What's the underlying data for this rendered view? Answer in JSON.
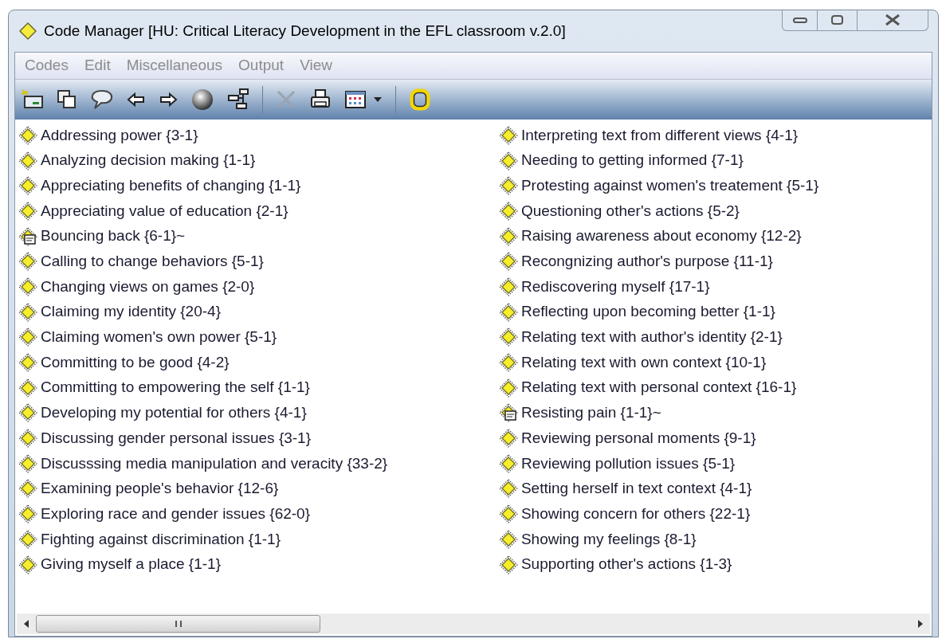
{
  "window": {
    "title": "Code Manager [HU: Critical Literacy Development in the EFL classroom v.2.0]"
  },
  "menu": [
    "Codes",
    "Edit",
    "Miscellaneous",
    "Output",
    "View"
  ],
  "codes": [
    {
      "label": "Addressing power {3-1}",
      "kind": "code"
    },
    {
      "label": "Analyzing decision making {1-1}",
      "kind": "code"
    },
    {
      "label": "Appreciating benefits of changing {1-1}",
      "kind": "code"
    },
    {
      "label": "Appreciating value of education {2-1}",
      "kind": "code"
    },
    {
      "label": "Bouncing back {6-1}~",
      "kind": "commented"
    },
    {
      "label": "Calling to change behaviors {5-1}",
      "kind": "code"
    },
    {
      "label": "Changing views on games {2-0}",
      "kind": "code"
    },
    {
      "label": "Claiming my identity {20-4}",
      "kind": "code"
    },
    {
      "label": "Claiming women's own power {5-1}",
      "kind": "code"
    },
    {
      "label": "Committing to be good {4-2}",
      "kind": "code"
    },
    {
      "label": "Committing to empowering the self {1-1}",
      "kind": "code"
    },
    {
      "label": "Developing my potential for others {4-1}",
      "kind": "code"
    },
    {
      "label": "Discussing gender personal issues {3-1}",
      "kind": "code"
    },
    {
      "label": "Discusssing media manipulation and veracity {33-2}",
      "kind": "code"
    },
    {
      "label": "Examining people's behavior {12-6}",
      "kind": "code"
    },
    {
      "label": "Exploring race and gender issues {62-0}",
      "kind": "code"
    },
    {
      "label": "Fighting against discrimination {1-1}",
      "kind": "code"
    },
    {
      "label": "Giving myself a place {1-1}",
      "kind": "code"
    },
    {
      "label": "Interpreting text from different views {4-1}",
      "kind": "code"
    },
    {
      "label": "Needing to getting informed {7-1}",
      "kind": "code"
    },
    {
      "label": "Protesting against women's treatement {5-1}",
      "kind": "code"
    },
    {
      "label": "Questioning other's actions {5-2}",
      "kind": "code"
    },
    {
      "label": "Raising awareness about economy {12-2}",
      "kind": "code"
    },
    {
      "label": "Recongnizing author's purpose {11-1}",
      "kind": "code"
    },
    {
      "label": "Rediscovering myself {17-1}",
      "kind": "code"
    },
    {
      "label": "Reflecting upon becoming better {1-1}",
      "kind": "code"
    },
    {
      "label": "Relating text with author's identity {2-1}",
      "kind": "code"
    },
    {
      "label": "Relating text with own context {10-1}",
      "kind": "code"
    },
    {
      "label": "Relating text with personal context {16-1}",
      "kind": "code"
    },
    {
      "label": "Resisting pain {1-1}~",
      "kind": "commented"
    },
    {
      "label": "Reviewing personal moments {9-1}",
      "kind": "code"
    },
    {
      "label": "Reviewing pollution issues {5-1}",
      "kind": "code"
    },
    {
      "label": "Setting herself in text context {4-1}",
      "kind": "code"
    },
    {
      "label": "Showing concern for others {22-1}",
      "kind": "code"
    },
    {
      "label": "Showing my feelings {8-1}",
      "kind": "code"
    },
    {
      "label": "Supporting other's actions {1-3}",
      "kind": "code"
    }
  ]
}
